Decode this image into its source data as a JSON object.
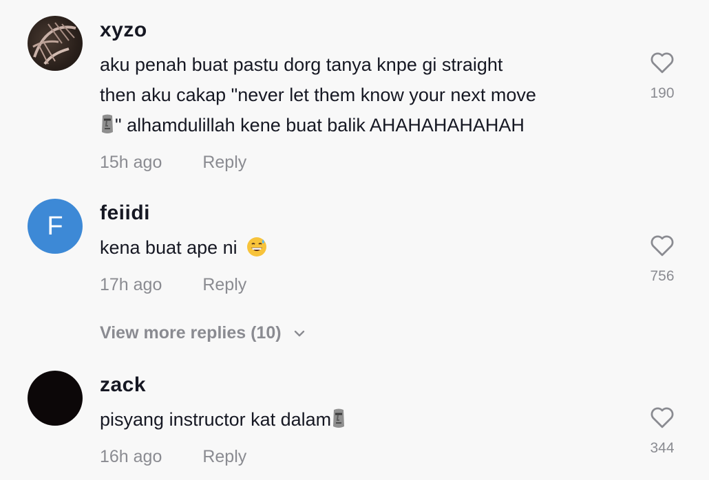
{
  "comments": [
    {
      "username": "xyzo",
      "avatar": "photo-avatar",
      "text_line1": "aku penah buat pastu dorg tanya knpe gi straight",
      "text_line2": "then aku cakap \"never let them know your next move",
      "text_line3_emoji": "moai-emoji",
      "text_line3": "\" alhamdulillah kene buat balik AHAHAHAHAHAH",
      "time": "15h ago",
      "reply_label": "Reply",
      "likes": "190",
      "like_icon": "heart-outline-icon"
    },
    {
      "username": "feiidi",
      "avatar_letter": "F",
      "avatar_color": "#3d89d6",
      "text": "kena buat ape ni",
      "emoji": "grinning-sweat-emoji",
      "time": "17h ago",
      "reply_label": "Reply",
      "likes": "756",
      "like_icon": "heart-outline-icon"
    },
    {
      "username": "zack",
      "avatar_color": "#0c0708",
      "text": "pisyang instructor kat dalam",
      "emoji": "moai-emoji",
      "time": "16h ago",
      "reply_label": "Reply",
      "likes": "344",
      "like_icon": "heart-outline-icon"
    }
  ],
  "view_more_replies": {
    "label": "View more replies (10)",
    "icon": "chevron-down-icon"
  },
  "colors": {
    "background": "#f8f8f8",
    "text_primary": "#161823",
    "text_secondary": "#8a8b91"
  }
}
